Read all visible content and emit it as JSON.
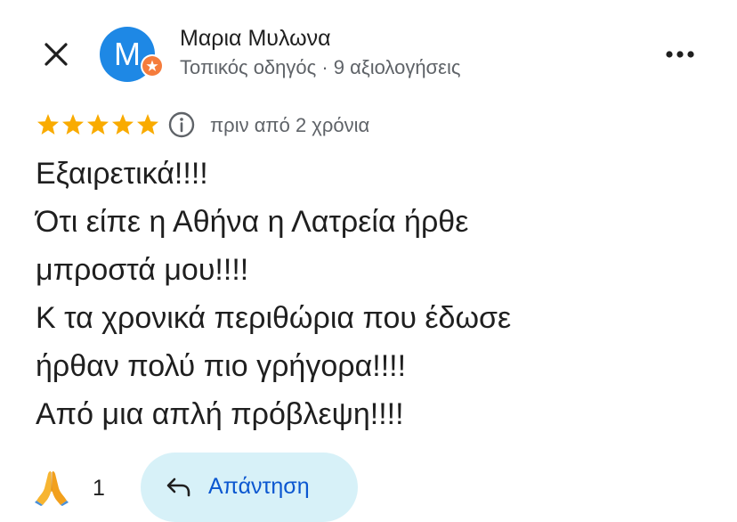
{
  "header": {
    "close_icon": "close-icon",
    "avatar_letter": "M",
    "avatar_color": "#1e88e5",
    "badge_color": "#f57c3c",
    "author_name": "Μαρια Μυλωνα",
    "author_meta": "Τοπικός οδηγός · 9 αξιολογήσεις",
    "more_icon": "more-horizontal-icon"
  },
  "review": {
    "rating": 5,
    "rating_max": 5,
    "star_color": "#f9ab00",
    "date": "πριν από 2 χρόνια",
    "lines": [
      "Εξαιρετικά!!!!",
      "Ότι είπε η Αθήνα η Λατρεία ήρθε",
      "μπροστά μου!!!!",
      "Κ τα χρονικά περιθώρια που έδωσε",
      "ήρθαν πολύ πιο γρήγορα!!!!",
      "Από μια απλή πρόβλεψη!!!!"
    ]
  },
  "actions": {
    "reaction_icon": "folded-hands-icon",
    "reaction_count": "1",
    "reply_label": "Απάντηση",
    "reply_icon": "reply-arrow-icon",
    "reply_bg": "#d7f1f8",
    "reply_color": "#0b57d0"
  }
}
